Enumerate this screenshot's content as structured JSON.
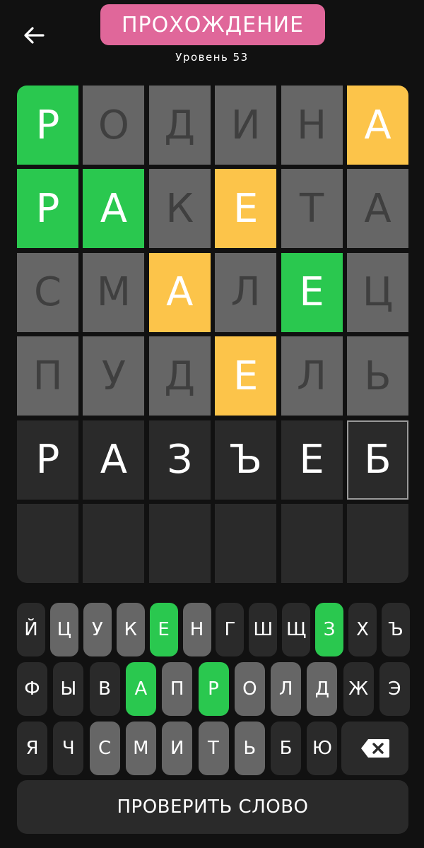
{
  "header": {
    "title": "ПРОХОЖДЕНИЕ",
    "level": "Уровень 53",
    "back_icon": "arrow-left-icon"
  },
  "colors": {
    "background": "#111111",
    "title_pill": "#e0679a",
    "correct": "#2ac84f",
    "present": "#fcc44a",
    "absent": "#666666",
    "absent_text": "#3f3f3f",
    "empty": "#2a2a2a",
    "active": "#2a2a2a",
    "key_default": "#2a2a2a",
    "key_absent": "#666666",
    "cursor_border": "#9a9a9a",
    "button": "#2a2a2a"
  },
  "board": {
    "rows": [
      [
        {
          "letter": "Р",
          "state": "correct"
        },
        {
          "letter": "О",
          "state": "absent"
        },
        {
          "letter": "Д",
          "state": "absent"
        },
        {
          "letter": "И",
          "state": "absent"
        },
        {
          "letter": "Н",
          "state": "absent"
        },
        {
          "letter": "А",
          "state": "present"
        }
      ],
      [
        {
          "letter": "Р",
          "state": "correct"
        },
        {
          "letter": "А",
          "state": "correct"
        },
        {
          "letter": "К",
          "state": "absent"
        },
        {
          "letter": "Е",
          "state": "present"
        },
        {
          "letter": "Т",
          "state": "absent"
        },
        {
          "letter": "А",
          "state": "absent"
        }
      ],
      [
        {
          "letter": "С",
          "state": "absent"
        },
        {
          "letter": "М",
          "state": "absent"
        },
        {
          "letter": "А",
          "state": "present"
        },
        {
          "letter": "Л",
          "state": "absent"
        },
        {
          "letter": "Е",
          "state": "correct"
        },
        {
          "letter": "Ц",
          "state": "absent"
        }
      ],
      [
        {
          "letter": "П",
          "state": "absent"
        },
        {
          "letter": "У",
          "state": "absent"
        },
        {
          "letter": "Д",
          "state": "absent"
        },
        {
          "letter": "Е",
          "state": "present"
        },
        {
          "letter": "Л",
          "state": "absent"
        },
        {
          "letter": "Ь",
          "state": "absent"
        }
      ],
      [
        {
          "letter": "Р",
          "state": "active"
        },
        {
          "letter": "А",
          "state": "active"
        },
        {
          "letter": "З",
          "state": "active"
        },
        {
          "letter": "Ъ",
          "state": "active"
        },
        {
          "letter": "Е",
          "state": "active"
        },
        {
          "letter": "Б",
          "state": "cursor"
        }
      ],
      [
        {
          "letter": "",
          "state": "empty"
        },
        {
          "letter": "",
          "state": "empty"
        },
        {
          "letter": "",
          "state": "empty"
        },
        {
          "letter": "",
          "state": "empty"
        },
        {
          "letter": "",
          "state": "empty"
        },
        {
          "letter": "",
          "state": "empty"
        }
      ]
    ]
  },
  "keyboard": {
    "rows": [
      [
        {
          "key": "Й",
          "state": "default"
        },
        {
          "key": "Ц",
          "state": "absent"
        },
        {
          "key": "У",
          "state": "absent"
        },
        {
          "key": "К",
          "state": "absent"
        },
        {
          "key": "Е",
          "state": "correct"
        },
        {
          "key": "Н",
          "state": "absent"
        },
        {
          "key": "Г",
          "state": "default"
        },
        {
          "key": "Ш",
          "state": "default"
        },
        {
          "key": "Щ",
          "state": "default"
        },
        {
          "key": "З",
          "state": "correct"
        },
        {
          "key": "Х",
          "state": "default"
        },
        {
          "key": "Ъ",
          "state": "default"
        }
      ],
      [
        {
          "key": "Ф",
          "state": "default"
        },
        {
          "key": "Ы",
          "state": "default"
        },
        {
          "key": "В",
          "state": "default"
        },
        {
          "key": "А",
          "state": "correct"
        },
        {
          "key": "П",
          "state": "absent"
        },
        {
          "key": "Р",
          "state": "correct"
        },
        {
          "key": "О",
          "state": "absent"
        },
        {
          "key": "Л",
          "state": "absent"
        },
        {
          "key": "Д",
          "state": "absent"
        },
        {
          "key": "Ж",
          "state": "default"
        },
        {
          "key": "Э",
          "state": "default"
        }
      ],
      [
        {
          "key": "Я",
          "state": "default"
        },
        {
          "key": "Ч",
          "state": "default"
        },
        {
          "key": "С",
          "state": "absent"
        },
        {
          "key": "М",
          "state": "absent"
        },
        {
          "key": "И",
          "state": "absent"
        },
        {
          "key": "Т",
          "state": "absent"
        },
        {
          "key": "Ь",
          "state": "absent"
        },
        {
          "key": "Б",
          "state": "default"
        },
        {
          "key": "Ю",
          "state": "default"
        }
      ]
    ],
    "backspace_icon": "backspace-icon"
  },
  "actions": {
    "check_label": "ПРОВЕРИТЬ СЛОВО"
  }
}
